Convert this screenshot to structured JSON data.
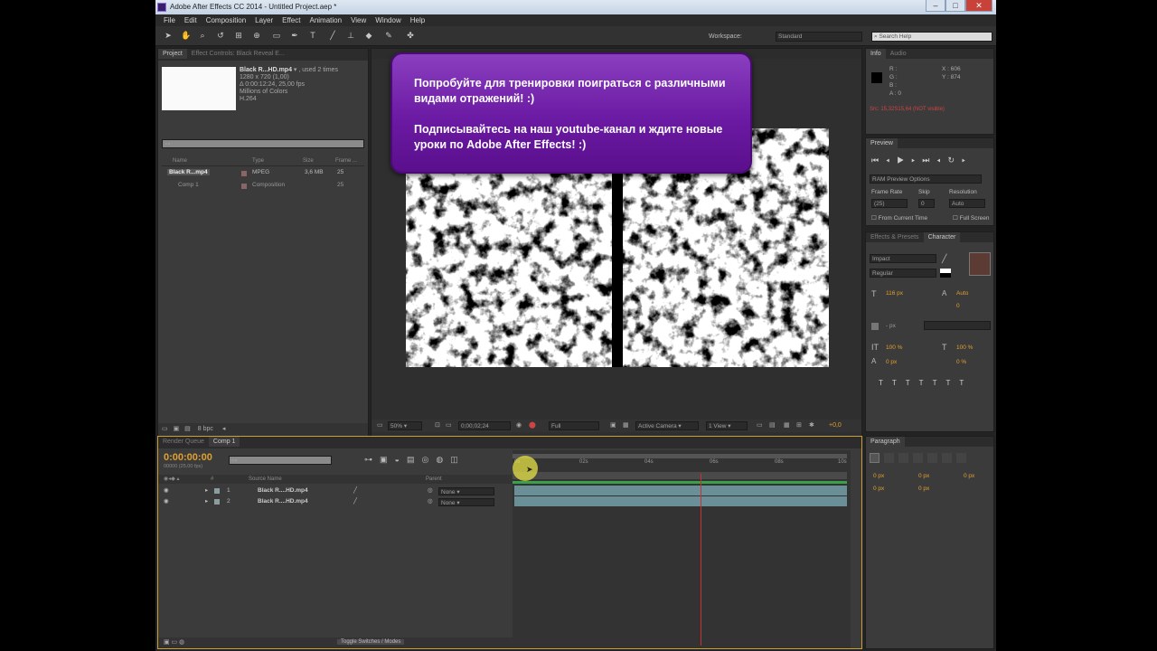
{
  "window": {
    "title": "Adobe After Effects CC 2014 - Untitled Project.aep *"
  },
  "menu": [
    "File",
    "Edit",
    "Composition",
    "Layer",
    "Effect",
    "Animation",
    "View",
    "Window",
    "Help"
  ],
  "toolbar": {
    "workspace_label": "Workspace:",
    "workspace_value": "Standard",
    "search_placeholder": "Search Help"
  },
  "project_panel": {
    "tabs": [
      "Project",
      "Effect Controls: Black Reveal E..."
    ],
    "selected_item": "Black R...HD.mp4",
    "used_text": ", used 2 times",
    "info_lines": [
      "1280 x 720 (1,00)",
      "Δ 0:00:12:24, 25,00 fps",
      "Millions of Colors",
      "H.264"
    ],
    "columns": [
      "Name",
      "Type",
      "Size",
      "Frame ..."
    ],
    "rows": [
      {
        "name": "Black R...mp4",
        "type": "MPEG",
        "size": "3,6 MB",
        "frame": "25"
      },
      {
        "name": "Comp 1",
        "type": "Composition",
        "size": "",
        "frame": "25"
      }
    ],
    "bpc": "8 bpc"
  },
  "composition_panel": {
    "zoom": "50%",
    "timecode": "0;00;02;24",
    "resolution": "Full",
    "camera": "Active Camera",
    "views": "1 View",
    "exposure": "+0,0"
  },
  "overlay": {
    "line1": "Попробуйте для тренировки поиграться с различными видами отражений! :)",
    "line2": "Подписывайтесь на наш youtube-канал и ждите новые уроки по Adobe After Effects! :)"
  },
  "info_panel": {
    "tabs": [
      "Info",
      "Audio"
    ],
    "r": "R :",
    "g": "G :",
    "b": "B :",
    "a": "A : 0",
    "x": "X : 606",
    "y": "Y : 874",
    "status": "Src: 15,32S15,64 (NOT visible)"
  },
  "preview_panel": {
    "tab": "Preview",
    "ram_options": "RAM Preview Options",
    "frame_rate_label": "Frame Rate",
    "skip_label": "Skip",
    "resolution_label": "Resolution",
    "frame_rate": "(25)",
    "skip": "0",
    "resolution": "Auto",
    "from_current": "From Current Time",
    "full_screen": "Full Screen"
  },
  "character_panel": {
    "tabs": [
      "Effects & Presets",
      "Character"
    ],
    "font": "Impact",
    "style": "Regular",
    "size": "116 px",
    "leading": "Auto",
    "kerning": "0",
    "stroke": "- px",
    "vscale": "100 %",
    "hscale": "100 %",
    "baseline": "0 px",
    "tsume": "0 %",
    "swatch_color": "#5b3b33"
  },
  "paragraph_panel": {
    "tab": "Paragraph",
    "values": [
      "0 px",
      "0 px",
      "0 px",
      "0 px",
      "0 px"
    ]
  },
  "timeline": {
    "tabs": [
      "Render Queue",
      "Comp 1"
    ],
    "timecode": "0:00:00:00",
    "fps_text": "00000 (25.00 fps)",
    "columns": [
      "#",
      "Source Name",
      "Parent"
    ],
    "layers": [
      {
        "num": "1",
        "name": "Black R....HD.mp4",
        "parent": "None"
      },
      {
        "num": "2",
        "name": "Black R....HD.mp4",
        "parent": "None"
      }
    ],
    "ruler": [
      "0s",
      "02s",
      "04s",
      "06s",
      "08s",
      "10s"
    ],
    "toggle_label": "Toggle Switches / Modes"
  }
}
